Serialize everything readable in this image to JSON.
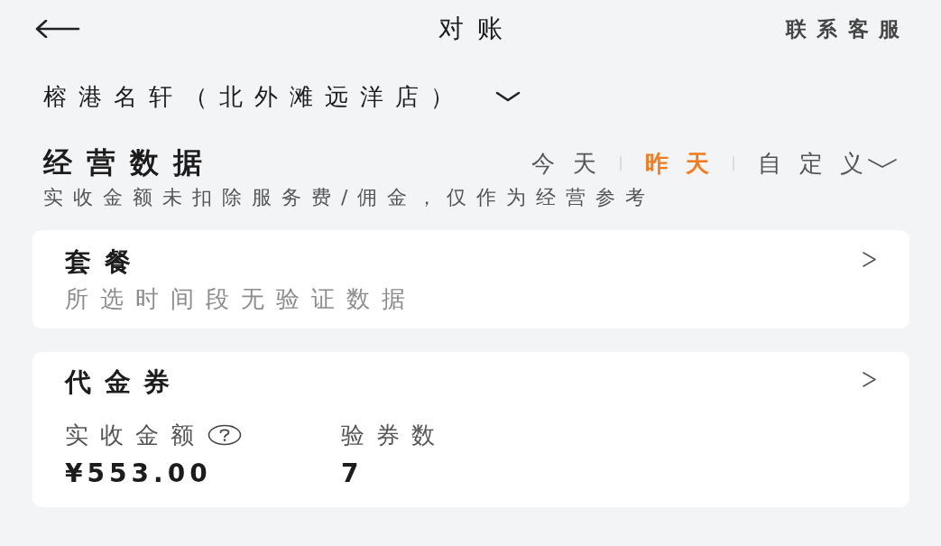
{
  "header": {
    "title": "对账",
    "action": "联系客服"
  },
  "store": {
    "name": "榕港名轩（北外滩远洋店）"
  },
  "business": {
    "title": "经营数据",
    "periods": [
      {
        "label": "今天",
        "selected": false,
        "kind": "plain"
      },
      {
        "label": "昨天",
        "selected": true,
        "kind": "plain"
      },
      {
        "label": "自定义",
        "selected": false,
        "kind": "dropdown"
      }
    ],
    "note": "实收金额未扣除服务费/佣金，仅作为经营参考"
  },
  "cards": [
    {
      "title": "套餐",
      "kind": "empty",
      "message": "所选时间段无验证数据"
    },
    {
      "title": "代金券",
      "kind": "stats",
      "metrics": [
        {
          "label": "实收金额",
          "help": true,
          "value": "¥553.00"
        },
        {
          "label": "验券数",
          "help": false,
          "value": "7"
        }
      ]
    }
  ]
}
